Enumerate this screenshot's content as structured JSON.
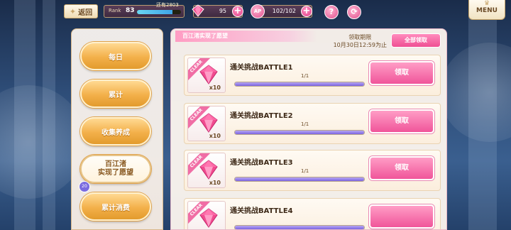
{
  "topbar": {
    "back_label": "返回",
    "rank_label": "Rank",
    "rank_value": "83",
    "rank_progress": 0.8,
    "rank_next_label": "还有2803",
    "gems_value": "95",
    "ap_label": "AP",
    "ap_value": "102/102",
    "help_symbol": "?",
    "menu_label": "MENU"
  },
  "categories": [
    {
      "label": "每日"
    },
    {
      "label": "累计"
    },
    {
      "label": "收集养成"
    },
    {
      "label_line1": "百江渚",
      "label_line2": "实现了愿望",
      "badge": "20",
      "active": true
    },
    {
      "label": "累计消费"
    }
  ],
  "panel": {
    "title": "百江渚实现了愿望",
    "deadline_line1": "领取期限",
    "deadline_line2": "10月30日12:59为止",
    "claim_all_label": "全部领取"
  },
  "missions": [
    {
      "title": "通关挑战BATTLE1",
      "progress_text": "1/1",
      "progress": 1.0,
      "qty": "x10",
      "clear": "CLEAR",
      "claim_label": "领取"
    },
    {
      "title": "通关挑战BATTLE2",
      "progress_text": "1/1",
      "progress": 1.0,
      "qty": "x10",
      "clear": "CLEAR",
      "claim_label": "领取"
    },
    {
      "title": "通关挑战BATTLE3",
      "progress_text": "1/1",
      "progress": 1.0,
      "qty": "x10",
      "clear": "CLEAR",
      "claim_label": "领取"
    },
    {
      "title": "通关挑战BATTLE4",
      "progress_text": "",
      "progress": 1.0,
      "qty": "",
      "clear": "CLEAR",
      "claim_label": ""
    }
  ],
  "colors": {
    "accent_pink": "#f0559a",
    "category_orange": "#f3b04a",
    "progress_purple": "#7c64e0"
  }
}
